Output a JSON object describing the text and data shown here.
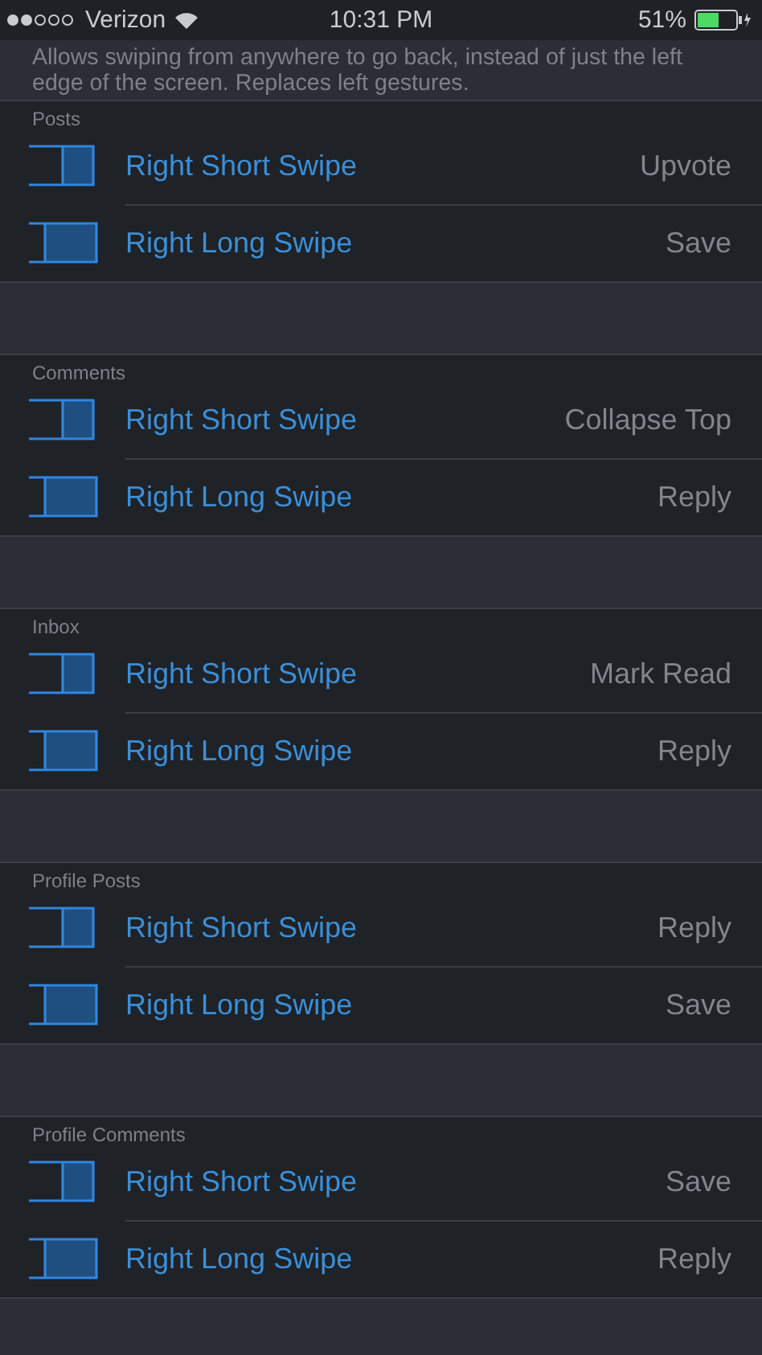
{
  "status_bar": {
    "carrier": "Verizon",
    "time": "10:31 PM",
    "battery": "51%"
  },
  "description": "Allows swiping from anywhere to go back, instead of just the left edge of the screen. Replaces left gestures.",
  "sections": [
    {
      "title": "Posts",
      "rows": [
        {
          "kind": "short",
          "label": "Right Short Swipe",
          "value": "Upvote"
        },
        {
          "kind": "long",
          "label": "Right Long Swipe",
          "value": "Save"
        }
      ]
    },
    {
      "title": "Comments",
      "rows": [
        {
          "kind": "short",
          "label": "Right Short Swipe",
          "value": "Collapse Top"
        },
        {
          "kind": "long",
          "label": "Right Long Swipe",
          "value": "Reply"
        }
      ]
    },
    {
      "title": "Inbox",
      "rows": [
        {
          "kind": "short",
          "label": "Right Short Swipe",
          "value": "Mark Read"
        },
        {
          "kind": "long",
          "label": "Right Long Swipe",
          "value": "Reply"
        }
      ]
    },
    {
      "title": "Profile Posts",
      "rows": [
        {
          "kind": "short",
          "label": "Right Short Swipe",
          "value": "Reply"
        },
        {
          "kind": "long",
          "label": "Right Long Swipe",
          "value": "Save"
        }
      ]
    },
    {
      "title": "Profile Comments",
      "rows": [
        {
          "kind": "short",
          "label": "Right Short Swipe",
          "value": "Save"
        },
        {
          "kind": "long",
          "label": "Right Long Swipe",
          "value": "Reply"
        }
      ]
    }
  ]
}
